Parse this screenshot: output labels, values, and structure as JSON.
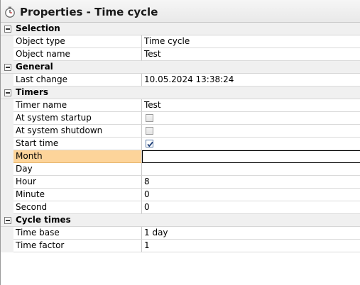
{
  "window": {
    "title": "Properties - Time cycle"
  },
  "categories": [
    {
      "label": "Selection",
      "rows": [
        {
          "name": "Object type",
          "value": "Time cycle",
          "type": "text"
        },
        {
          "name": "Object name",
          "value": "Test",
          "type": "text"
        }
      ]
    },
    {
      "label": "General",
      "rows": [
        {
          "name": "Last change",
          "value": "10.05.2024 13:38:24",
          "type": "text"
        }
      ]
    },
    {
      "label": "Timers",
      "rows": [
        {
          "name": "Timer name",
          "value": "Test",
          "type": "text"
        },
        {
          "name": "At system startup",
          "checked": false,
          "type": "checkbox"
        },
        {
          "name": "At system shutdown",
          "checked": false,
          "type": "checkbox"
        },
        {
          "name": "Start time",
          "checked": true,
          "type": "checkbox"
        },
        {
          "name": "Month",
          "value": "",
          "type": "text",
          "selected": true
        },
        {
          "name": "Day",
          "value": "",
          "type": "text"
        },
        {
          "name": "Hour",
          "value": "8",
          "type": "text"
        },
        {
          "name": "Minute",
          "value": "0",
          "type": "text"
        },
        {
          "name": "Second",
          "value": "0",
          "type": "text"
        }
      ]
    },
    {
      "label": "Cycle times",
      "rows": [
        {
          "name": "Time base",
          "value": "1 day",
          "type": "text"
        },
        {
          "name": "Time factor",
          "value": "1",
          "type": "text"
        }
      ]
    }
  ],
  "icons": {
    "title": "stopwatch-icon",
    "collapse": "collapse-icon",
    "check": "checkmark-icon"
  },
  "colors": {
    "selected_row": "#fdd49a",
    "category_bg": "#f0f0f0",
    "checkbox_check": "#1f3f77"
  }
}
